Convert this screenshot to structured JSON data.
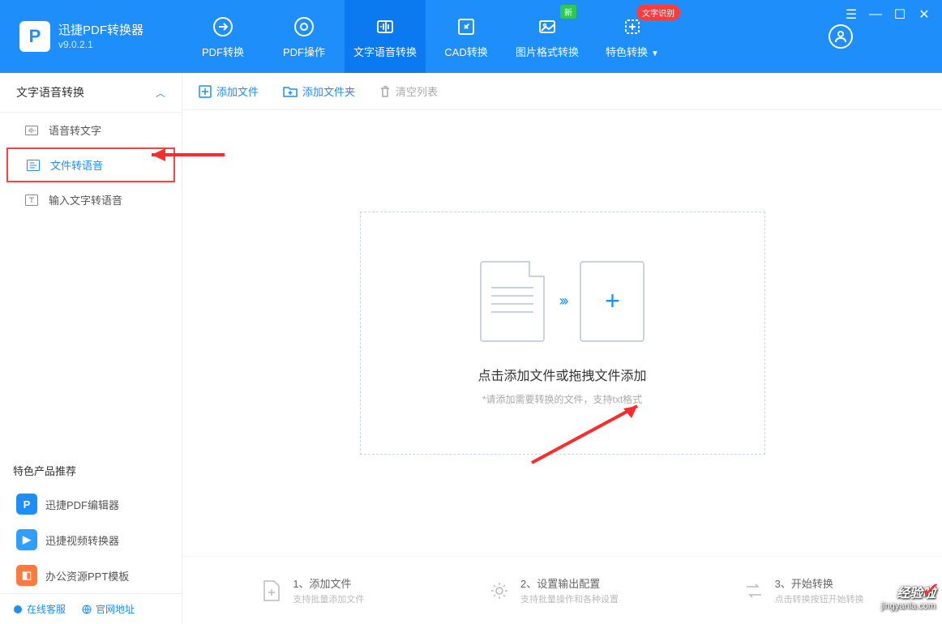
{
  "app": {
    "name": "迅捷PDF转换器",
    "version": "v9.0.2.1",
    "logo_letter": "P"
  },
  "nav": {
    "items": [
      {
        "label": "PDF转换"
      },
      {
        "label": "PDF操作"
      },
      {
        "label": "文字语音转换"
      },
      {
        "label": "CAD转换"
      },
      {
        "label": "图片格式转换",
        "badge": "新"
      },
      {
        "label": "特色转换",
        "badge_red": "文字识别"
      }
    ]
  },
  "sidebar": {
    "header": "文字语音转换",
    "items": [
      {
        "label": "语音转文字"
      },
      {
        "label": "文件转语音"
      },
      {
        "label": "输入文字转语音"
      }
    ]
  },
  "toolbar": {
    "add_file": "添加文件",
    "add_folder": "添加文件夹",
    "clear_list": "清空列表"
  },
  "dropzone": {
    "title": "点击添加文件或拖拽文件添加",
    "subtitle": "*请添加需要转换的文件，支持txt格式"
  },
  "steps": [
    {
      "title": "1、添加文件",
      "sub": "支持批量添加文件"
    },
    {
      "title": "2、设置输出配置",
      "sub": "支持批量操作和各种设置"
    },
    {
      "title": "3、开始转换",
      "sub": "点击转换按钮开始转换"
    }
  ],
  "recommend": {
    "title": "特色产品推荐",
    "items": [
      {
        "label": "迅捷PDF编辑器"
      },
      {
        "label": "迅捷视频转换器"
      },
      {
        "label": "办公资源PPT模板"
      }
    ]
  },
  "footer": {
    "service": "在线客服",
    "site": "官网地址"
  },
  "watermark": {
    "line1": "经验啦",
    "line2": "jingyanla.com"
  }
}
